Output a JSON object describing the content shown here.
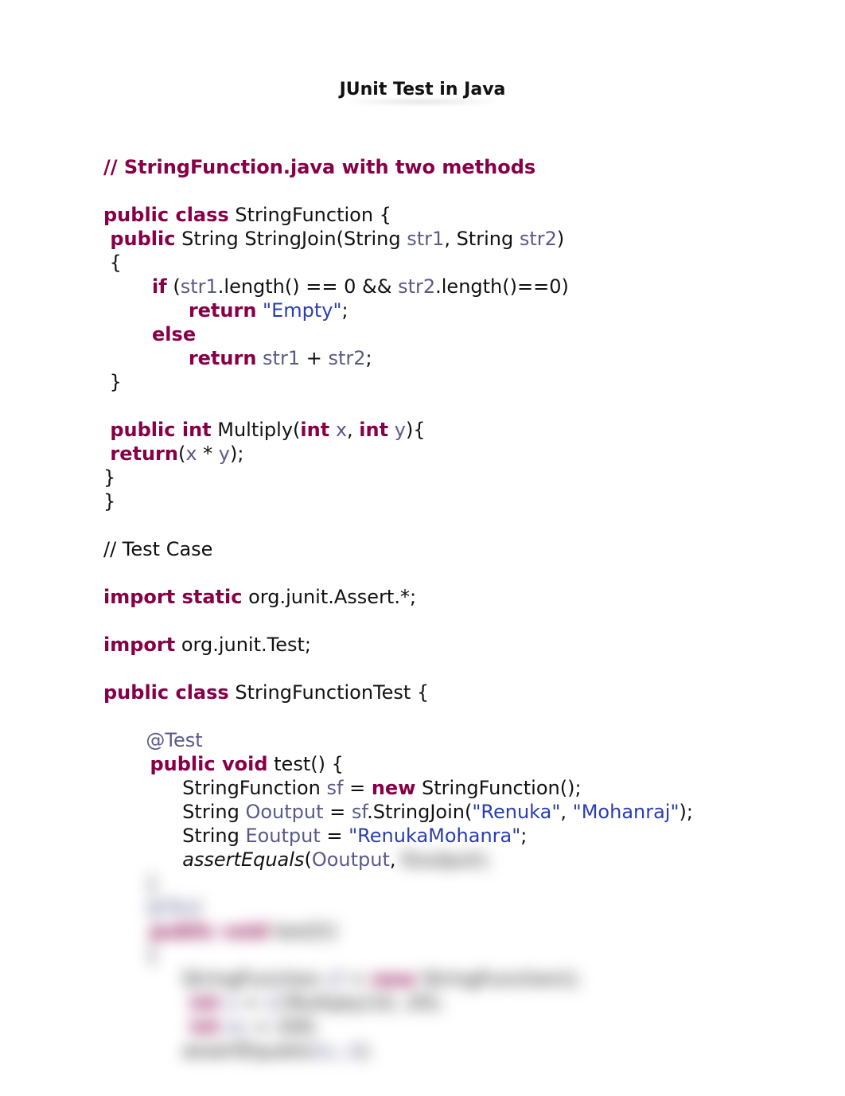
{
  "title": "JUnit Test in Java",
  "code": {
    "comment_header": "// StringFunction.java with two methods",
    "l1_kw1": "public class",
    "l1_name": " StringFunction {",
    "l2_kw": " public",
    "l2_txt1": " String StringJoin(String ",
    "l2_var1": "str1",
    "l2_txt2": ", String ",
    "l2_var2": "str2",
    "l2_txt3": ")",
    "l3": " {",
    "l4_indent": "        ",
    "l4_if": "if",
    "l4_txt1": " (",
    "l4_var1": "str1",
    "l4_txt2": ".length() == 0 && ",
    "l4_var2": "str2",
    "l4_txt3": ".length()==0)",
    "l5_indent": "              ",
    "l5_ret": "return",
    "l5_str": " \"Empty\"",
    "l5_end": ";",
    "l6_indent": "        ",
    "l6_else": "else",
    "l7_indent": "              ",
    "l7_ret": "return",
    "l7_sp": " ",
    "l7_var1": "str1",
    "l7_plus": " + ",
    "l7_var2": "str2",
    "l7_end": ";",
    "l8": " }",
    "l10_kw": " public int",
    "l10_txt1": " Multiply(",
    "l10_int1": "int",
    "l10_sp1": " ",
    "l10_var1": "x",
    "l10_txt2": ", ",
    "l10_int2": "int",
    "l10_sp2": " ",
    "l10_var2": "y",
    "l10_txt3": "){",
    "l11_kw": " return",
    "l11_txt1": "(",
    "l11_var1": "x",
    "l11_txt2": " * ",
    "l11_var2": "y",
    "l11_txt3": ");",
    "l12": "}",
    "l13": "}",
    "tc_label": "// Test Case",
    "imp1_kw": "import static",
    "imp1_txt": " org.junit.Assert.*;",
    "imp2_kw": "import",
    "imp2_txt": " org.junit.Test;",
    "cls2_kw": "public class",
    "cls2_txt": " StringFunctionTest {",
    "t_at": "       @Test",
    "t_kw": "       public void",
    "t_txt": " test() {",
    "t_l1a": "             StringFunction ",
    "t_l1_var": "sf",
    "t_l1b": " = ",
    "t_l1_new": "new",
    "t_l1c": " StringFunction();",
    "t_l2a": "             String ",
    "t_l2_var": "Ooutput",
    "t_l2b": " = ",
    "t_l2_var2": "sf",
    "t_l2c": ".StringJoin(",
    "t_l2_str1": "\"Renuka\"",
    "t_l2d": ", ",
    "t_l2_str2": "\"Mohanraj\"",
    "t_l2e": ");",
    "t_l3a": "             String ",
    "t_l3_var": "Eoutput",
    "t_l3b": " = ",
    "t_l3_str": "\"RenukaMohanra\"",
    "t_l3c": ";",
    "t_l4a": "             ",
    "t_l4_fn": "assertEquals",
    "t_l4b": "(",
    "t_l4_var": "Ooutput",
    "t_l4c": ",",
    "blur1": "       }",
    "blur2": "       @Test",
    "blur3_kw": "       public void",
    "blur3_txt": " test2()",
    "blur4": "       {",
    "blur5a": "             StringFunction ",
    "blur5_var": "sf",
    "blur5b": " = ",
    "blur5_new": "new",
    "blur5c": " StringFunction();",
    "blur6_kw": "             int",
    "blur6a": " ",
    "blur6_var": "o",
    "blur6b": " = ",
    "blur6_var2": "sf",
    "blur6c": ".Multiply(10, 20);",
    "blur7_kw": "             int",
    "blur7a": " ",
    "blur7_var": "ex",
    "blur7b": " = 200;",
    "blur8a": "             assertEquals(",
    "blur8_var": "ex",
    "blur8b": ", ",
    "blur8_var2": "o",
    "blur8c": ");"
  }
}
